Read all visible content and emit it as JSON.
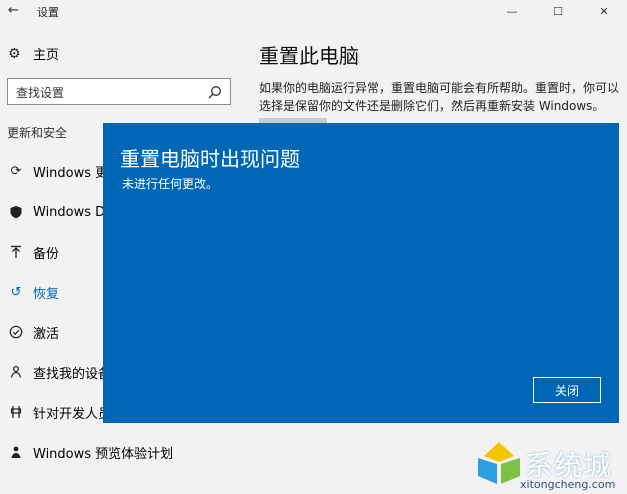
{
  "window": {
    "title": "设置",
    "back_glyph": "←",
    "minimize_glyph": "—",
    "maximize_glyph": "☐",
    "close_glyph": "✕"
  },
  "sidebar": {
    "home": {
      "label": "主页",
      "icon": "gear-icon"
    },
    "search": {
      "placeholder": "查找设置",
      "icon": "search-icon"
    },
    "section_title": "更新和安全",
    "items": [
      {
        "label": "Windows 更新",
        "icon": "sync-icon"
      },
      {
        "label": "Windows Defender",
        "icon": "shield-icon"
      },
      {
        "label": "备份",
        "icon": "backup-arrow-icon"
      },
      {
        "label": "恢复",
        "icon": "recovery-icon",
        "selected": true
      },
      {
        "label": "激活",
        "icon": "check-circle-icon"
      },
      {
        "label": "查找我的设备",
        "icon": "person-pin-icon"
      },
      {
        "label": "针对开发人员",
        "icon": "developer-icon"
      },
      {
        "label": "Windows 预览体验计划",
        "icon": "insider-icon"
      }
    ]
  },
  "main": {
    "title": "重置此电脑",
    "description": "如果你的电脑运行异常，重置电脑可能会有所帮助。重置时，你可以选择是保留你的文件还是删除它们，然后再重新安装 Windows。"
  },
  "dialog": {
    "title": "重置电脑时出现问题",
    "message": "未进行任何更改。",
    "close_button": "关闭",
    "background_color": "#0066b6"
  },
  "watermark": {
    "text": "系统城",
    "url": "xitongcheng.com"
  },
  "colors": {
    "accent": "#0063b1",
    "window_bg": "#f2f2f2"
  }
}
